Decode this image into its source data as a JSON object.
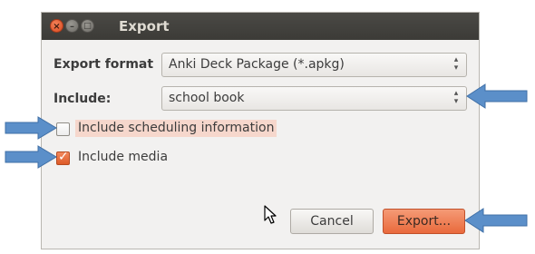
{
  "window": {
    "title": "Export",
    "controls": {
      "close": "×",
      "minimize": "–",
      "maximize": "□"
    }
  },
  "form": {
    "export_format_label": "Export format",
    "export_format_value": "Anki Deck Package (*.apkg)",
    "include_label": "Include:",
    "include_value": "school book",
    "combo_arrow": "⌃⌄",
    "scheduling_label": "Include scheduling information",
    "scheduling_checked": false,
    "media_label": "Include media",
    "media_checked": true,
    "check_glyph": "✓"
  },
  "buttons": {
    "cancel_label": "Cancel",
    "export_label": "Export..."
  },
  "colors": {
    "accent_orange": "#e96a3c",
    "titlebar": "#3c3b37",
    "annotation_arrow": "#5b8fc9"
  }
}
